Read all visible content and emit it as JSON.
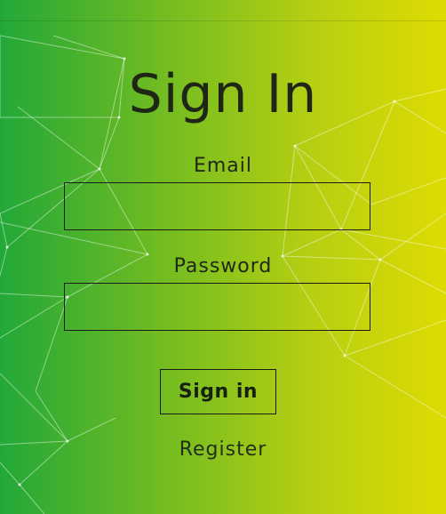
{
  "page": {
    "title": "Sign In",
    "email_label": "Email",
    "email_value": "",
    "password_label": "Password",
    "password_value": "",
    "submit_label": "Sign in",
    "register_label": "Register"
  },
  "colors": {
    "gradient_start": "#22a838",
    "gradient_end": "#dedb02",
    "text": "#1f2616",
    "border": "#1b1b1b"
  }
}
